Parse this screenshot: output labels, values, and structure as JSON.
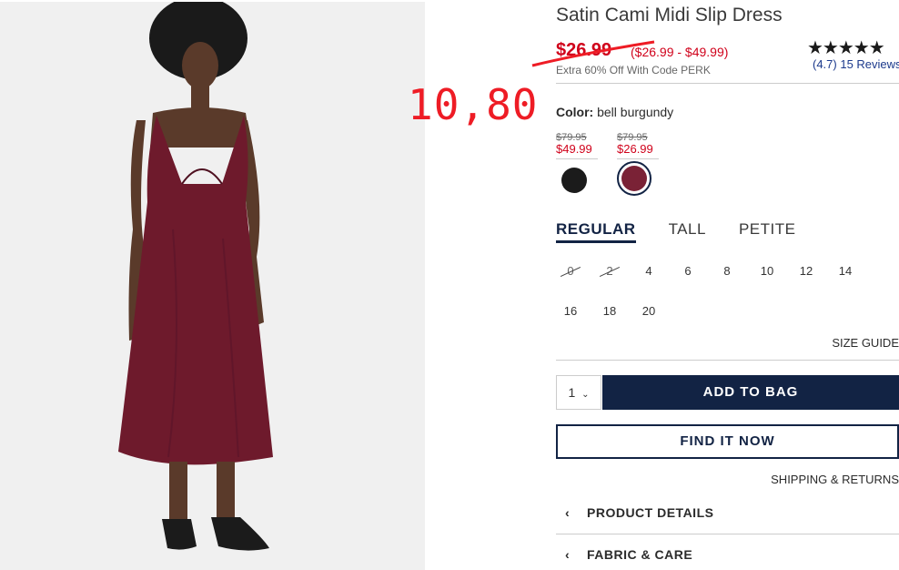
{
  "product": {
    "title": "Satin Cami Midi Slip Dress",
    "price": "$26.99",
    "price_range": "($26.99 - $49.99)",
    "promo": "Extra 60% Off With Code PERK",
    "rating_stars": "★★★★★",
    "rating_value": 4.7,
    "rating_text": "(4.7) 15 Reviews"
  },
  "annotation": {
    "number": "10,80",
    "color": "#ee1c25"
  },
  "color": {
    "label": "Color:",
    "selected": "bell burgundy",
    "swatches": [
      {
        "old_price": "$79.95",
        "new_price": "$49.99",
        "hex": "#1b1b1b"
      },
      {
        "old_price": "$79.95",
        "new_price": "$26.99",
        "hex": "#7a2236"
      }
    ]
  },
  "fit_tabs": [
    "REGULAR",
    "TALL",
    "PETITE"
  ],
  "sizes": [
    "0",
    "2",
    "4",
    "6",
    "8",
    "10",
    "12",
    "14",
    "16",
    "18",
    "20"
  ],
  "unavailable_sizes": [
    "0",
    "2"
  ],
  "size_guide": "SIZE GUIDE",
  "quantity": "1",
  "buttons": {
    "add_to_bag": "ADD TO BAG",
    "find_it_now": "FIND IT NOW"
  },
  "shipping": "SHIPPING & RETURNS",
  "sections": [
    "PRODUCT DETAILS",
    "FABRIC & CARE"
  ],
  "colors": {
    "navy": "#122344",
    "sale_red": "#d0021b",
    "dress": "#6e1a2c"
  }
}
